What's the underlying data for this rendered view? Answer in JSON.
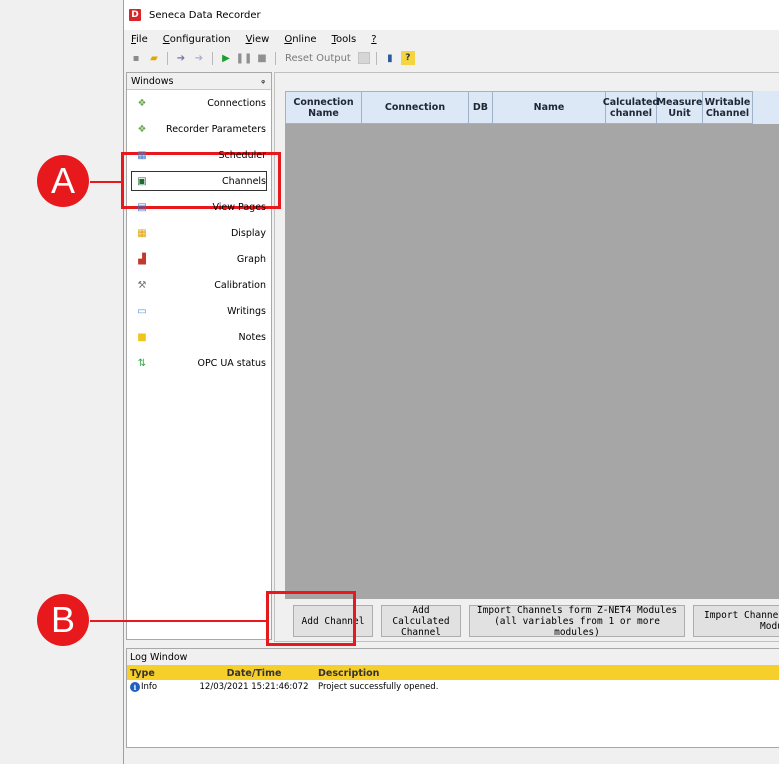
{
  "window": {
    "title": "Seneca Data Recorder",
    "app_icon_letter": "D"
  },
  "menu": [
    {
      "underline": "F",
      "rest": "ile"
    },
    {
      "underline": "C",
      "rest": "onfiguration"
    },
    {
      "underline": "V",
      "rest": "iew"
    },
    {
      "underline": "O",
      "rest": "nline"
    },
    {
      "underline": "T",
      "rest": "ools"
    },
    {
      "underline": "?",
      "rest": ""
    }
  ],
  "toolbar": {
    "reset_output": "Reset Output"
  },
  "windows_panel": {
    "title": "Windows",
    "pin": "ᵩ",
    "items": [
      {
        "label": "Connections",
        "icon": "connections-icon"
      },
      {
        "label": "Recorder Parameters",
        "icon": "recorder-parameters-icon"
      },
      {
        "label": "Scheduler",
        "icon": "scheduler-icon"
      },
      {
        "label": "Channels",
        "icon": "channels-icon"
      },
      {
        "label": "View Pages",
        "icon": "view-pages-icon"
      },
      {
        "label": "Display",
        "icon": "display-icon"
      },
      {
        "label": "Graph",
        "icon": "graph-icon"
      },
      {
        "label": "Calibration",
        "icon": "calibration-icon"
      },
      {
        "label": "Writings",
        "icon": "writings-icon"
      },
      {
        "label": "Notes",
        "icon": "notes-icon"
      },
      {
        "label": "OPC UA status",
        "icon": "opc-ua-status-icon"
      }
    ],
    "selected": "Channels"
  },
  "grid": {
    "columns": [
      "Connection Name",
      "Connection",
      "DB",
      "Name",
      "Calculated channel",
      "Measure Unit",
      "Writable Channel"
    ]
  },
  "buttons": {
    "add_channel": "Add Channel",
    "add_calculated_1": "Add Calculated",
    "add_calculated_2": "Channel",
    "import_znet4_1": "Import Channels form Z-NET4 Modules",
    "import_znet4_2": "(all variables from 1 or more modules)",
    "import_channels_1": "Import Channels",
    "import_channels_2": "Modul"
  },
  "log": {
    "title": "Log Window",
    "headers": {
      "type": "Type",
      "date": "Date/Time",
      "description": "Description"
    },
    "rows": [
      {
        "type": "Info",
        "date": "12/03/2021 15:21:46:072",
        "description": "Project successfully opened."
      }
    ]
  },
  "callouts": {
    "a": "A",
    "b": "B"
  },
  "colors": {
    "callout_red": "#e8191c",
    "log_header": "#f7cf2a",
    "grid_bg": "#a6a6a6"
  }
}
